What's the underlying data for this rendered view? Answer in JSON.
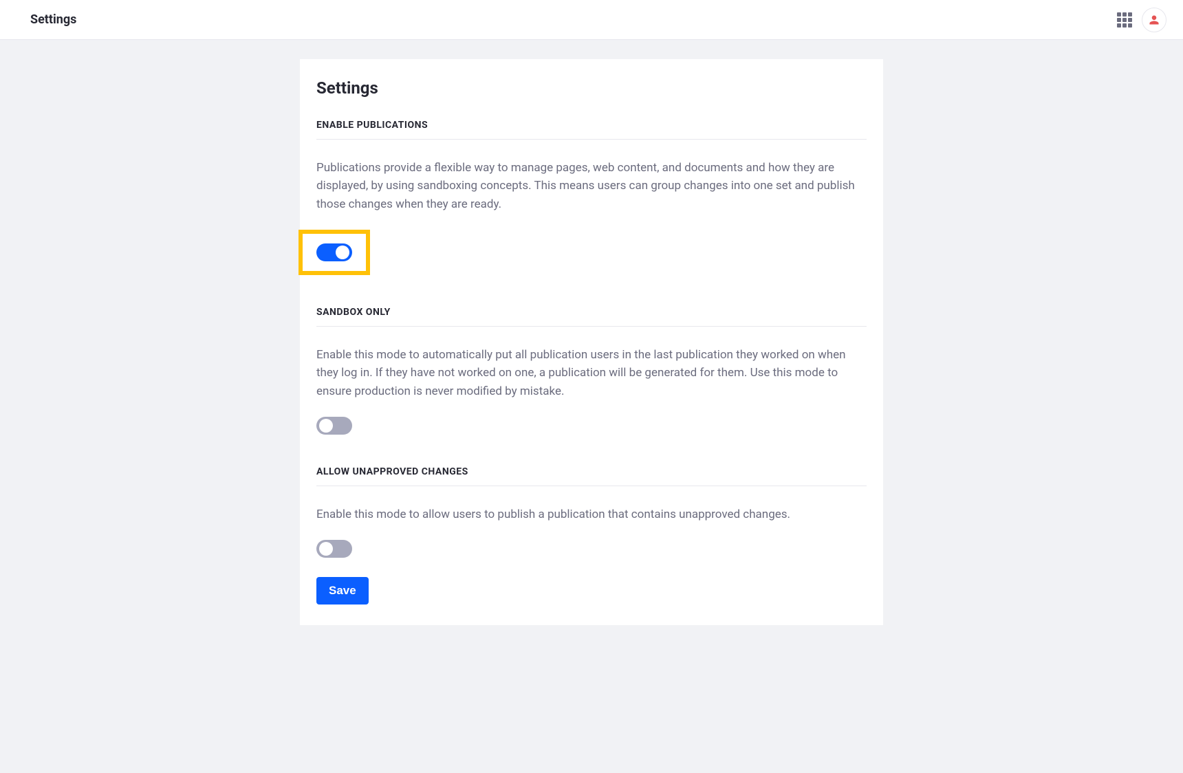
{
  "topbar": {
    "title": "Settings"
  },
  "panel": {
    "title": "Settings",
    "sections": [
      {
        "heading": "ENABLE PUBLICATIONS",
        "description": "Publications provide a flexible way to manage pages, web content, and documents and how they are displayed, by using sandboxing concepts. This means users can group changes into one set and publish those changes when they are ready.",
        "toggle_on": true,
        "highlighted": true
      },
      {
        "heading": "SANDBOX ONLY",
        "description": "Enable this mode to automatically put all publication users in the last publication they worked on when they log in. If they have not worked on one, a publication will be generated for them. Use this mode to ensure production is never modified by mistake.",
        "toggle_on": false,
        "highlighted": false
      },
      {
        "heading": "ALLOW UNAPPROVED CHANGES",
        "description": "Enable this mode to allow users to publish a publication that contains unapproved changes.",
        "toggle_on": false,
        "highlighted": false
      }
    ],
    "save_label": "Save"
  }
}
